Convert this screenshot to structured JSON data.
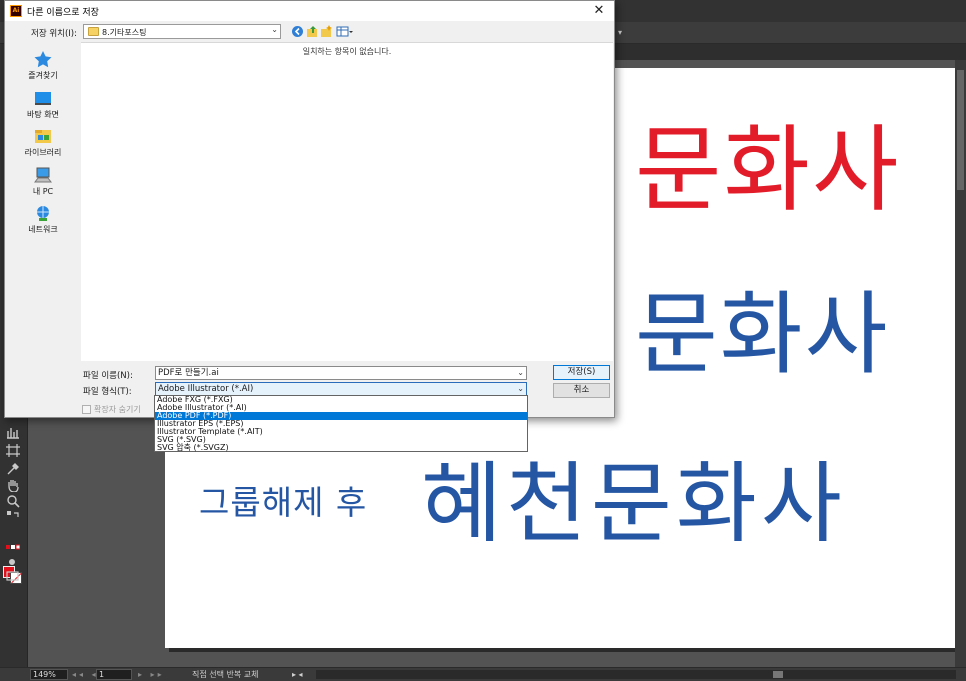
{
  "dialog": {
    "title": "다른 이름으로 저장",
    "save_in_label": "저장 위치(I):",
    "current_folder": "8.기타포스팅",
    "empty_message": "일치하는 항목이 없습니다.",
    "places": [
      {
        "label": "즐겨찾기",
        "icon": "star-icon"
      },
      {
        "label": "바탕 화면",
        "icon": "desktop-icon"
      },
      {
        "label": "라이브러리",
        "icon": "library-icon"
      },
      {
        "label": "내 PC",
        "icon": "computer-icon"
      },
      {
        "label": "네트워크",
        "icon": "network-icon"
      }
    ],
    "filename_label": "파일 이름(N):",
    "filename_value": "PDF로 만들기.ai",
    "filetype_label": "파일 형식(T):",
    "filetype_value": "Adobe Illustrator (*.AI)",
    "filetype_options": [
      "Adobe FXG (*.FXG)",
      "Adobe Illustrator (*.AI)",
      "Adobe PDF (*.PDF)",
      "Illustrator EPS (*.EPS)",
      "Illustrator Template (*.AIT)",
      "SVG (*.SVG)",
      "SVG 압축 (*.SVGZ)"
    ],
    "filetype_highlighted_index": 2,
    "hide_ext_label": "확장자 숨기기",
    "save_button": "저장(S)",
    "cancel_button": "취소",
    "close_glyph": "✕",
    "app_icon_text": "Ai"
  },
  "artboard": {
    "red_text": "문화사",
    "blue_text": "문화사",
    "caption": "그룹해제 후",
    "big_text": "혜천문화사"
  },
  "status": {
    "zoom": "149%",
    "page": "1",
    "tool_text": "직접 선택 반복 교체"
  },
  "colors": {
    "accent": "#0078d7",
    "red_text": "#e31c2a",
    "blue_text": "#2456a4",
    "fill_swatch": "#e3101c"
  }
}
